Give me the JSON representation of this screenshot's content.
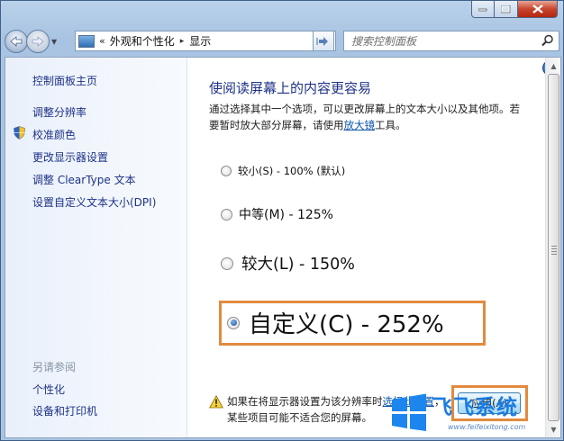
{
  "window": {
    "caption_buttons": [
      "minimize-icon",
      "maximize-icon",
      "close-icon"
    ]
  },
  "navbar": {
    "back_icon": "back-arrow-icon",
    "forward_icon": "forward-arrow-icon",
    "address": {
      "overflow": "«",
      "crumb1": "外观和个性化",
      "separator": "▸",
      "crumb2": "显示"
    },
    "search_placeholder": "搜索控制面板"
  },
  "sidebar": {
    "home": "控制面板主页",
    "items": [
      "调整分辨率",
      "校准颜色",
      "更改显示器设置",
      "调整 ClearType 文本",
      "设置自定义文本大小(DPI)"
    ],
    "see_also_heading": "另请参阅",
    "see_also": [
      "个性化",
      "设备和打印机"
    ]
  },
  "main": {
    "title": "使阅读屏幕上的内容更容易",
    "desc_line1": "通过选择其中一个选项，可以更改屏幕上的文本大小以及其他项。若",
    "desc_line2_pre": "要暂时放大部分屏幕，请使用",
    "desc_link": "放大镜",
    "desc_line2_post": "工具。",
    "options": [
      {
        "label": "较小(S) - 100% (默认)",
        "selected": false
      },
      {
        "label": "中等(M) - 125%",
        "selected": false
      },
      {
        "label": "较大(L) - 150%",
        "selected": false
      },
      {
        "label": "自定义(C) - 252%",
        "selected": true
      }
    ],
    "warning": {
      "line1_pre": "如果在将显示器设置为该分辨率时",
      "link": "选择此设置",
      "line1_post": "，",
      "line2": "某些项目可能不适合您的屏幕。"
    },
    "apply_label": "应用(A)"
  },
  "watermark": {
    "title": "飞飞系统",
    "url": "www.feifeixitong.com"
  },
  "colors": {
    "link": "#1e3287",
    "highlight_box": "#e28a3e"
  }
}
